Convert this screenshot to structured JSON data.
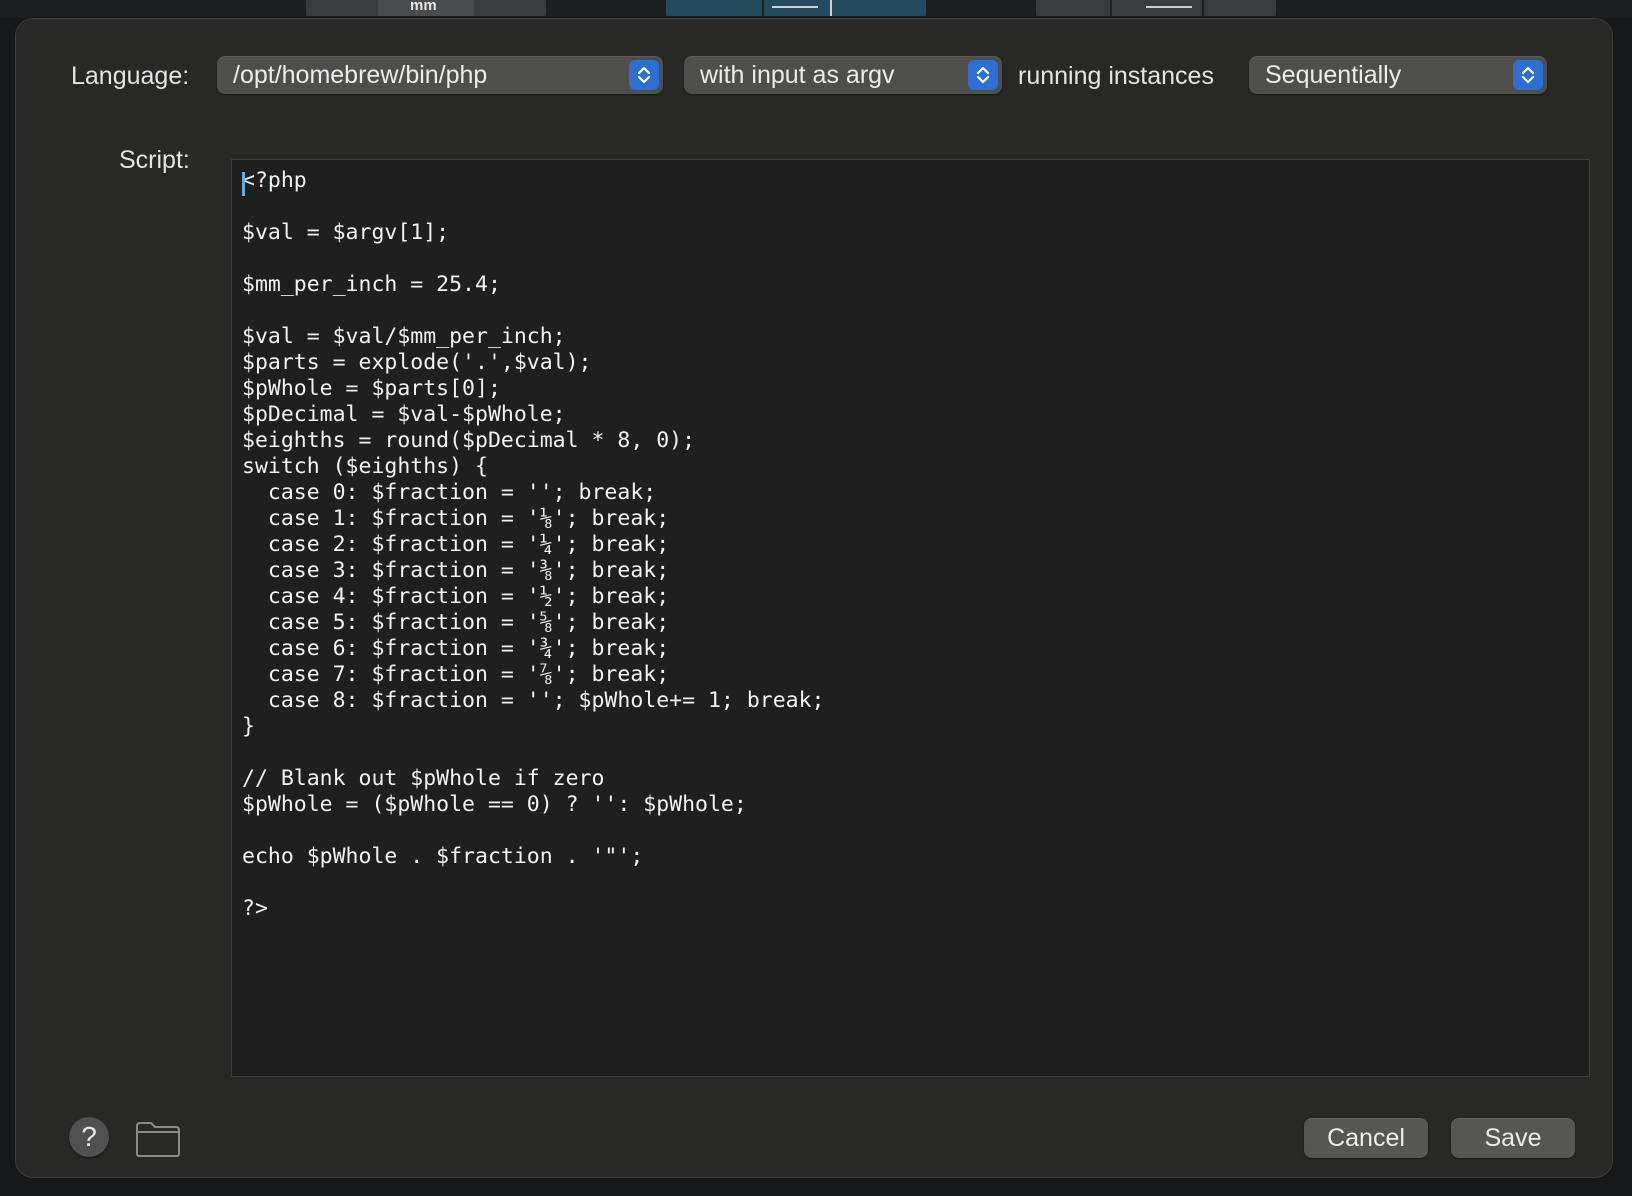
{
  "background_toolbar": {
    "segment_label": "mm"
  },
  "form": {
    "language_label": "Language:",
    "language_value": "/opt/homebrew/bin/php",
    "input_mode_value": "with input as argv",
    "running_instances_label": "running instances",
    "instances_value": "Sequentially",
    "script_label": "Script:"
  },
  "script": {
    "code": "<?php\n\n$val = $argv[1];\n\n$mm_per_inch = 25.4;\n\n$val = $val/$mm_per_inch;\n$parts = explode('.',$val);\n$pWhole = $parts[0];\n$pDecimal = $val-$pWhole;\n$eighths = round($pDecimal * 8, 0);\nswitch ($eighths) {\n  case 0: $fraction = ''; break;\n  case 1: $fraction = '⅛'; break;\n  case 2: $fraction = '¼'; break;\n  case 3: $fraction = '⅜'; break;\n  case 4: $fraction = '½'; break;\n  case 5: $fraction = '⅝'; break;\n  case 6: $fraction = '¾'; break;\n  case 7: $fraction = '⅞'; break;\n  case 8: $fraction = ''; $pWhole+= 1; break;\n}\n\n// Blank out $pWhole if zero\n$pWhole = ($pWhole == 0) ? '': $pWhole;\n\necho $pWhole . $fraction . '\"';\n\n?>"
  },
  "footer": {
    "help_glyph": "?",
    "help_icon": "question-mark-icon",
    "folder_icon": "folder-icon",
    "cancel_label": "Cancel",
    "save_label": "Save"
  },
  "colors": {
    "sheet_background": "#282826",
    "editor_background": "#1f1f1f",
    "accent_stepper": "#2d6fd2",
    "button_background": "#565654"
  }
}
